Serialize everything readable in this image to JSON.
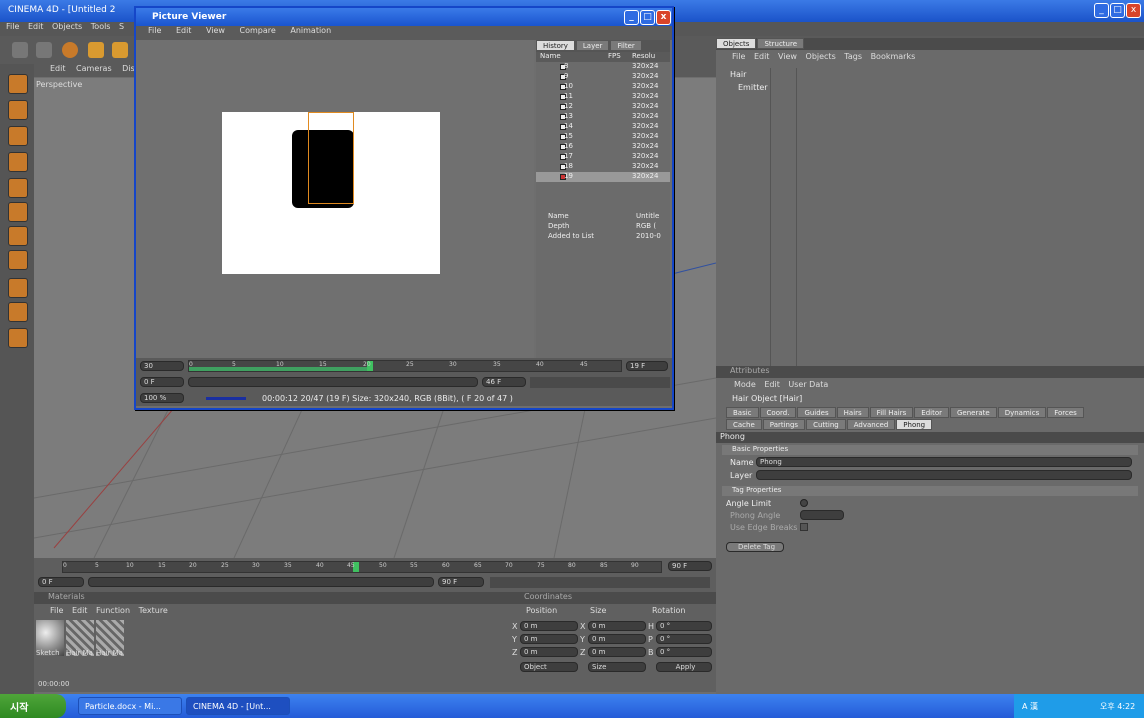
{
  "app": {
    "title": "CINEMA 4D - [Untitled 2"
  },
  "menubar": [
    "File",
    "Edit",
    "Objects",
    "Tools",
    "S"
  ],
  "viewport": {
    "menu": [
      "Edit",
      "Cameras",
      "Disp"
    ],
    "label": "Perspective"
  },
  "timeline": {
    "ticks": [
      "0",
      "5",
      "10",
      "15",
      "20",
      "25",
      "30",
      "35",
      "40",
      "45",
      "50",
      "55",
      "60",
      "65",
      "70",
      "75",
      "80",
      "85",
      "90"
    ],
    "end_label": "90 F",
    "frame_left": "0 F",
    "frame_right": "90 F"
  },
  "materials": {
    "title": "Materials",
    "menu": [
      "File",
      "Edit",
      "Function",
      "Texture"
    ],
    "items": [
      "Sketch",
      "Hair Ma",
      "Hair Ma"
    ]
  },
  "coordinates": {
    "title": "Coordinates",
    "headers": [
      "Position",
      "Size",
      "Rotation"
    ],
    "rows": [
      {
        "axis": "X",
        "pos": "0 m",
        "size_axis": "X",
        "size": "0 m",
        "rot_axis": "H",
        "rot": "0 °"
      },
      {
        "axis": "Y",
        "pos": "0 m",
        "size_axis": "Y",
        "size": "0 m",
        "rot_axis": "P",
        "rot": "0 °"
      },
      {
        "axis": "Z",
        "pos": "0 m",
        "size_axis": "Z",
        "size": "0 m",
        "rot_axis": "B",
        "rot": "0 °"
      }
    ],
    "mode_object": "Object",
    "mode_size": "Size",
    "apply": "Apply"
  },
  "status": {
    "time": "00:00:00"
  },
  "objects": {
    "tabs": [
      "Objects",
      "Structure"
    ],
    "menu": [
      "File",
      "Edit",
      "View",
      "Objects",
      "Tags",
      "Bookmarks"
    ],
    "items": [
      "Hair",
      "Emitter"
    ]
  },
  "attributes": {
    "title": "Attributes",
    "menu": [
      "Mode",
      "Edit",
      "User Data"
    ],
    "object": "Hair Object [Hair]",
    "tabs_row1": [
      "Basic",
      "Coord.",
      "Guides",
      "Hairs",
      "Fill Hairs",
      "Editor",
      "Generate",
      "Dynamics",
      "Forces"
    ],
    "tabs_row2": [
      "Cache",
      "Partings",
      "Cutting",
      "Advanced",
      "Phong"
    ],
    "section": "Phong",
    "basic_title": "Basic Properties",
    "name_label": "Name",
    "name_value": "Phong",
    "layer_label": "Layer",
    "tag_title": "Tag Properties",
    "angle_limit": "Angle Limit",
    "phong_angle": "Phong Angle",
    "edge_breaks": "Use Edge Breaks",
    "delete_tag": "Delete Tag"
  },
  "picture_viewer": {
    "title": "Picture Viewer",
    "menu": [
      "File",
      "Edit",
      "View",
      "Compare",
      "Animation"
    ],
    "tabs": [
      "History",
      "Layer",
      "Filter"
    ],
    "history_headers": [
      "Name",
      "FPS",
      "Resolu"
    ],
    "history_rows": [
      {
        "frame": "8",
        "res": "320x24"
      },
      {
        "frame": "9",
        "res": "320x24"
      },
      {
        "frame": "10",
        "res": "320x24"
      },
      {
        "frame": "11",
        "res": "320x24"
      },
      {
        "frame": "12",
        "res": "320x24"
      },
      {
        "frame": "13",
        "res": "320x24"
      },
      {
        "frame": "14",
        "res": "320x24"
      },
      {
        "frame": "15",
        "res": "320x24"
      },
      {
        "frame": "16",
        "res": "320x24"
      },
      {
        "frame": "17",
        "res": "320x24"
      },
      {
        "frame": "18",
        "res": "320x24"
      },
      {
        "frame": "19",
        "res": "320x24"
      }
    ],
    "info": [
      {
        "k": "Name",
        "v": "Untitle"
      },
      {
        "k": "Depth",
        "v": "RGB ("
      },
      {
        "k": "Added to List",
        "v": "2010-0"
      }
    ],
    "scrub_ticks": [
      "0",
      "5",
      "10",
      "15",
      "20",
      "25",
      "30",
      "35",
      "40",
      "45"
    ],
    "fps": "30",
    "end_frame": "19 F",
    "frame_left": "0 F",
    "frame_right": "46 F",
    "zoom": "100 %",
    "status": "00:00:12 20/47 (19 F)  Size: 320x240, RGB (8Bit),  ( F 20 of 47 )"
  },
  "taskbar": {
    "start": "시작",
    "items": [
      "Particle.docx - Mi...",
      "CINEMA 4D - [Unt..."
    ],
    "tray": "A 漢",
    "clock": "오후 4:22"
  },
  "colors": {
    "xp_blue": "#245bd8",
    "c4d_orange": "#c87a2a",
    "selection": "#ddd"
  }
}
